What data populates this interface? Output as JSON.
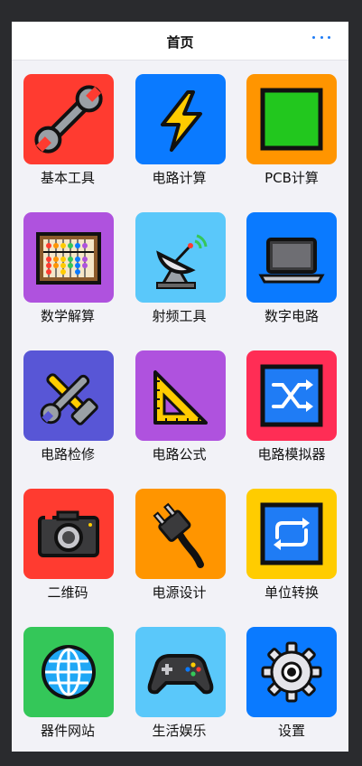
{
  "header": {
    "title": "首页",
    "more_icon": "ellipsis-icon"
  },
  "colors": {
    "accent": "#1f7cf5",
    "background": "#f2f2f7"
  },
  "apps": [
    {
      "label": "基本工具",
      "color": "#ff3b30",
      "icon": "wrench-icon"
    },
    {
      "label": "电路计算",
      "color": "#0a7aff",
      "icon": "lightning-icon"
    },
    {
      "label": "PCB计算",
      "color": "#ff9500",
      "icon": "square-icon"
    },
    {
      "label": "数学解算",
      "color": "#af52de",
      "icon": "abacus-icon"
    },
    {
      "label": "射频工具",
      "color": "#5ac8fa",
      "icon": "satellite-dish-icon"
    },
    {
      "label": "数字电路",
      "color": "#0a7aff",
      "icon": "laptop-icon"
    },
    {
      "label": "电路检修",
      "color": "#5856d6",
      "icon": "tools-icon"
    },
    {
      "label": "电路公式",
      "color": "#af52de",
      "icon": "set-square-icon"
    },
    {
      "label": "电路模拟器",
      "color": "#ff2d55",
      "icon": "shuffle-icon"
    },
    {
      "label": "二维码",
      "color": "#ff3b30",
      "icon": "camera-icon"
    },
    {
      "label": "电源设计",
      "color": "#ff9500",
      "icon": "power-plug-icon"
    },
    {
      "label": "单位转换",
      "color": "#ffcc00",
      "icon": "repeat-icon"
    },
    {
      "label": "器件网站",
      "color": "#34c759",
      "icon": "globe-icon"
    },
    {
      "label": "生活娱乐",
      "color": "#5ac8fa",
      "icon": "gamepad-icon"
    },
    {
      "label": "设置",
      "color": "#0a7aff",
      "icon": "gear-icon"
    }
  ]
}
